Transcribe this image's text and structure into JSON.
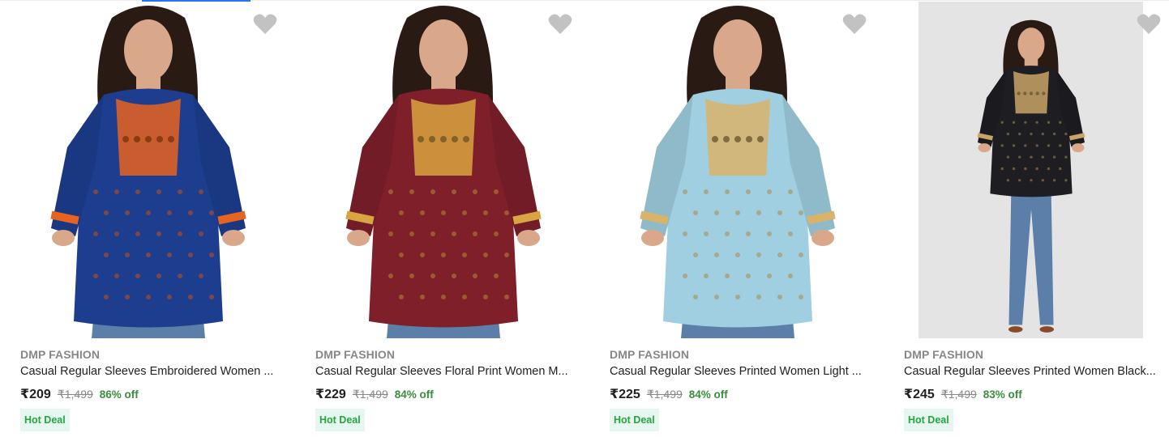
{
  "products": [
    {
      "brand": "DMP FASHION",
      "title": "Casual Regular Sleeves Embroidered Women ...",
      "price": "₹209",
      "mrp": "₹1,499",
      "discount": "86% off",
      "badge": "Hot Deal",
      "image_icon": "woman-navy-embroidered-top",
      "top_color": "#1d3d8f",
      "accent_color": "#e8631f",
      "bg_color": "#ffffff"
    },
    {
      "brand": "DMP FASHION",
      "title": "Casual Regular Sleeves Floral Print Women M...",
      "price": "₹229",
      "mrp": "₹1,499",
      "discount": "84% off",
      "badge": "Hot Deal",
      "image_icon": "woman-maroon-floral-top",
      "top_color": "#7e1f2a",
      "accent_color": "#d9a441",
      "bg_color": "#ffffff"
    },
    {
      "brand": "DMP FASHION",
      "title": "Casual Regular Sleeves Printed Women Light ...",
      "price": "₹225",
      "mrp": "₹1,499",
      "discount": "84% off",
      "badge": "Hot Deal",
      "image_icon": "woman-light-blue-printed-top",
      "top_color": "#9fcfe0",
      "accent_color": "#d9b36a",
      "bg_color": "#ffffff"
    },
    {
      "brand": "DMP FASHION",
      "title": "Casual Regular Sleeves Printed Women Black...",
      "price": "₹245",
      "mrp": "₹1,499",
      "discount": "83% off",
      "badge": "Hot Deal",
      "image_icon": "woman-black-printed-top",
      "top_color": "#1e1e22",
      "accent_color": "#c9a467",
      "bg_color": "#e4e4e4"
    }
  ],
  "colors": {
    "brand_text": "#878787",
    "discount_green": "#388e3c",
    "deal_bg": "#e5f7ee",
    "deal_text": "#26a541",
    "wishlist_heart": "#c2c2c2"
  },
  "icons": {
    "wishlist": "heart-icon"
  }
}
